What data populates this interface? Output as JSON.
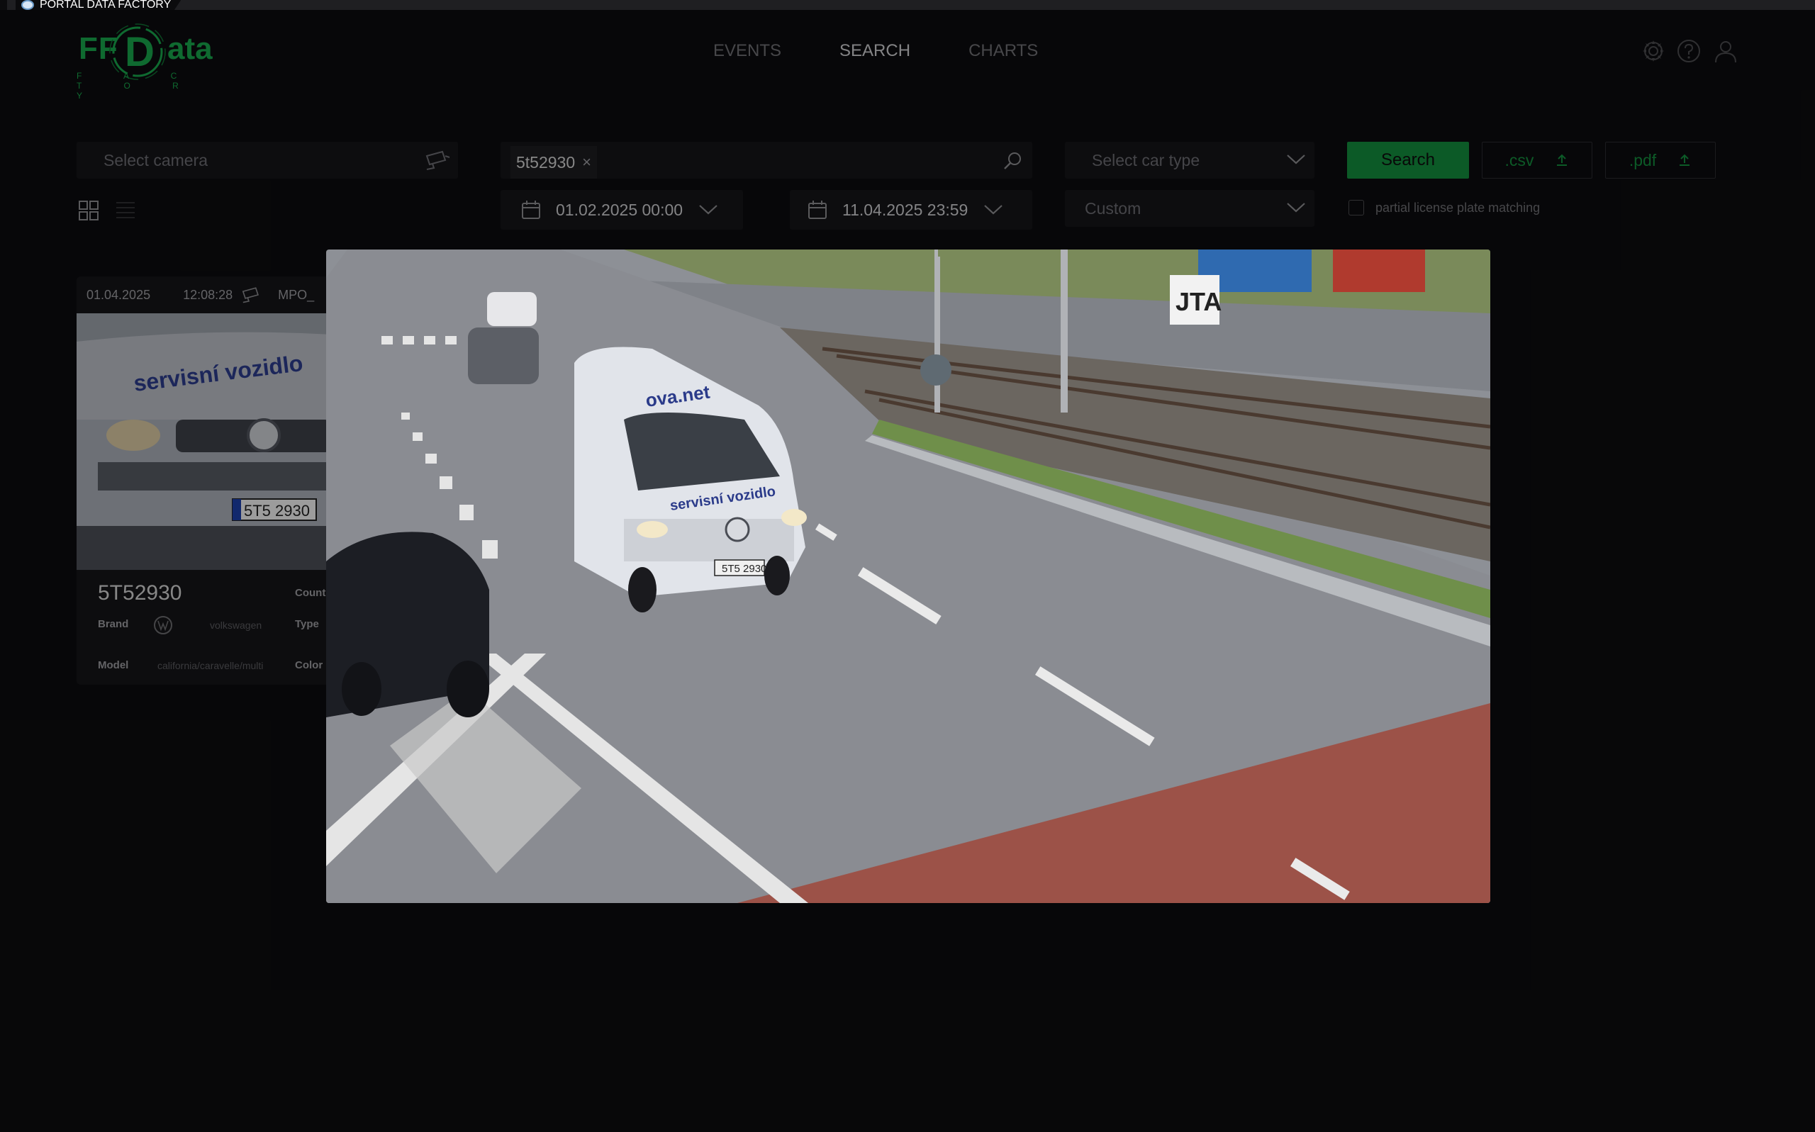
{
  "browser": {
    "tab_title": "PORTAL DATA FACTORY"
  },
  "logo": {
    "ff": "FF",
    "d": "D",
    "ata": "ata",
    "sub": "F A C T O R Y"
  },
  "nav": {
    "events": "EVENTS",
    "search": "SEARCH",
    "charts": "CHARTS",
    "active": "SEARCH"
  },
  "filters": {
    "camera_placeholder": "Select camera",
    "plate_chip": "5t52930",
    "car_type_placeholder": "Select car type",
    "date_from": "01.02.2025 00:00",
    "date_to": "11.04.2025 23:59",
    "period": "Custom",
    "search_button": "Search",
    "csv_button": ".csv",
    "pdf_button": ".pdf",
    "partial_match_label": "partial license plate matching",
    "partial_match_checked": false
  },
  "result_card": {
    "date": "01.04.2025",
    "time": "12:08:28",
    "camera": "MPO_",
    "plate": "5T52930",
    "country_label": "Count",
    "brand_label": "Brand",
    "brand_value": "volkswagen",
    "type_label": "Type",
    "model_label": "Model",
    "model_value": "california/caravelle/multi",
    "color_label": "Color",
    "van_text": "servisní vozidlo",
    "van_plate": "5T5 2930"
  },
  "modal_image": {
    "van_brand": "ova.net",
    "van_text": "servisní vozidlo",
    "van_plate": "5T5 2930",
    "billboard": "JTA"
  },
  "colors": {
    "accent_green": "#17a34a",
    "search_button": "#138a3c",
    "background": "#0c0c0e"
  }
}
